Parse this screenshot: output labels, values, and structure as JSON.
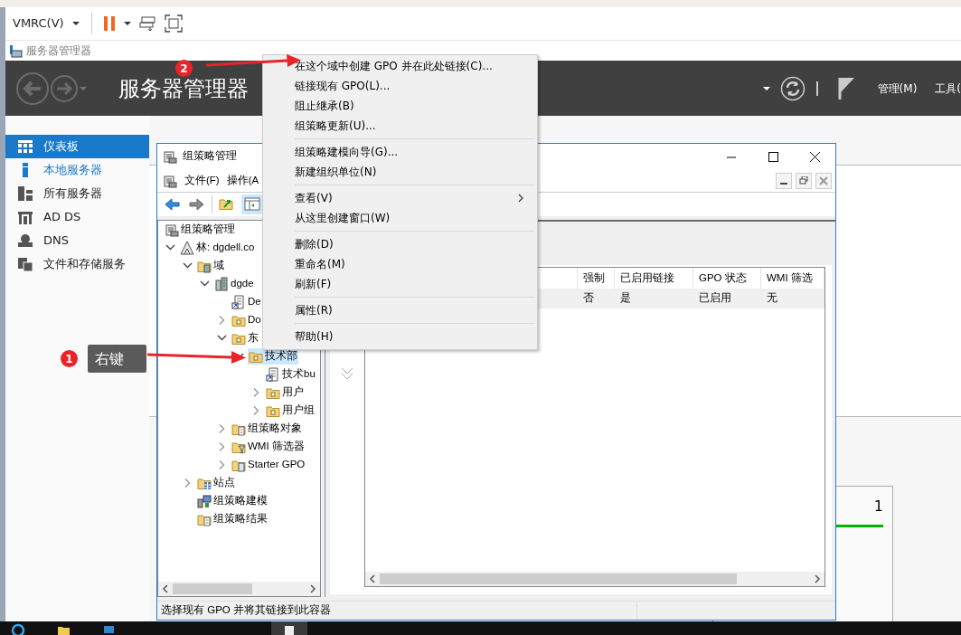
{
  "vmrc": {
    "menu": "VMRC(V)"
  },
  "server_manager": {
    "window_title": "服务器管理器",
    "title": "服务器管理器",
    "header_menus": [
      "管理(M)",
      "工具("
    ],
    "sidebar": [
      {
        "label": "仪表板",
        "kind": "dashboard",
        "selected": true,
        "hover": false
      },
      {
        "label": "本地服务器",
        "kind": "server",
        "selected": false,
        "hover": true
      },
      {
        "label": "所有服务器",
        "kind": "servers",
        "selected": false,
        "hover": false
      },
      {
        "label": "AD DS",
        "kind": "adds",
        "selected": false,
        "hover": false
      },
      {
        "label": "DNS",
        "kind": "dns",
        "selected": false,
        "hover": false
      },
      {
        "label": "文件和存储服务",
        "kind": "storage",
        "selected": false,
        "hover": false
      }
    ],
    "tile_count": "1"
  },
  "gpm": {
    "title": "组策略管理",
    "menus": [
      "文件(F)",
      "操作(A"
    ],
    "tree": {
      "label": "组策略管理",
      "kind": "console",
      "selected": false,
      "children": [
        {
          "label": "林: dgdell.co",
          "kind": "forest",
          "selected": false,
          "expanded": true,
          "children": [
            {
              "label": "域",
              "kind": "domains",
              "selected": false,
              "expanded": true,
              "children": [
                {
                  "label": "dgde",
                  "kind": "domain",
                  "selected": false,
                  "expanded": true,
                  "children": [
                    {
                      "label": "De",
                      "kind": "gpo-link",
                      "selected": false
                    },
                    {
                      "label": "Do",
                      "kind": "ou",
                      "selected": false,
                      "expanded": false
                    },
                    {
                      "label": "东",
                      "kind": "ou",
                      "selected": false,
                      "expanded": true,
                      "children": [
                        {
                          "label": "技术部",
                          "kind": "ou",
                          "selected": true,
                          "expanded": true,
                          "children": [
                            {
                              "label": "技术bu",
                              "kind": "gpo-link",
                              "selected": false
                            },
                            {
                              "label": "用户",
                              "kind": "ou",
                              "selected": false,
                              "expanded": false
                            },
                            {
                              "label": "用户组",
                              "kind": "ou",
                              "selected": false,
                              "expanded": false
                            }
                          ]
                        }
                      ]
                    },
                    {
                      "label": "组策略对象",
                      "kind": "gpo-folder",
                      "selected": false,
                      "expanded": false
                    },
                    {
                      "label": "WMI 筛选器",
                      "kind": "wmi-folder",
                      "selected": false,
                      "expanded": false
                    },
                    {
                      "label": "Starter GPO",
                      "kind": "starter-folder",
                      "selected": false,
                      "expanded": false
                    }
                  ]
                }
              ]
            },
            {
              "label": "站点",
              "kind": "sites",
              "selected": false,
              "expanded": false
            },
            {
              "label": "组策略建模",
              "kind": "modeling",
              "selected": false
            },
            {
              "label": "组策略结果",
              "kind": "results",
              "selected": false
            }
          ]
        }
      ]
    },
    "columns": [
      "强制",
      "已启用链接",
      "GPO 状态",
      "WMI 筛选"
    ],
    "rows": [
      [
        "否",
        "是",
        "已启用",
        "无"
      ]
    ],
    "status": "选择现有 GPO 并将其链接到此容器"
  },
  "context_menu": [
    [
      {
        "label": "在这个域中创建 GPO 并在此处链接(C)...",
        "submenu": false
      },
      {
        "label": "链接现有 GPO(L)...",
        "submenu": false
      },
      {
        "label": "阻止继承(B)",
        "submenu": false
      },
      {
        "label": "组策略更新(U)...",
        "submenu": false
      }
    ],
    [
      {
        "label": "组策略建模向导(G)...",
        "submenu": false
      },
      {
        "label": "新建组织单位(N)",
        "submenu": false
      }
    ],
    [
      {
        "label": "查看(V)",
        "submenu": true
      },
      {
        "label": "从这里创建窗口(W)",
        "submenu": false
      }
    ],
    [
      {
        "label": "删除(D)",
        "submenu": false
      },
      {
        "label": "重命名(M)",
        "submenu": false
      },
      {
        "label": "刷新(F)",
        "submenu": false
      }
    ],
    [
      {
        "label": "属性(R)",
        "submenu": false
      }
    ],
    [
      {
        "label": "帮助(H)",
        "submenu": false
      }
    ]
  ],
  "annotations": [
    {
      "number": "2"
    },
    {
      "number": "1",
      "note": "右键"
    }
  ]
}
